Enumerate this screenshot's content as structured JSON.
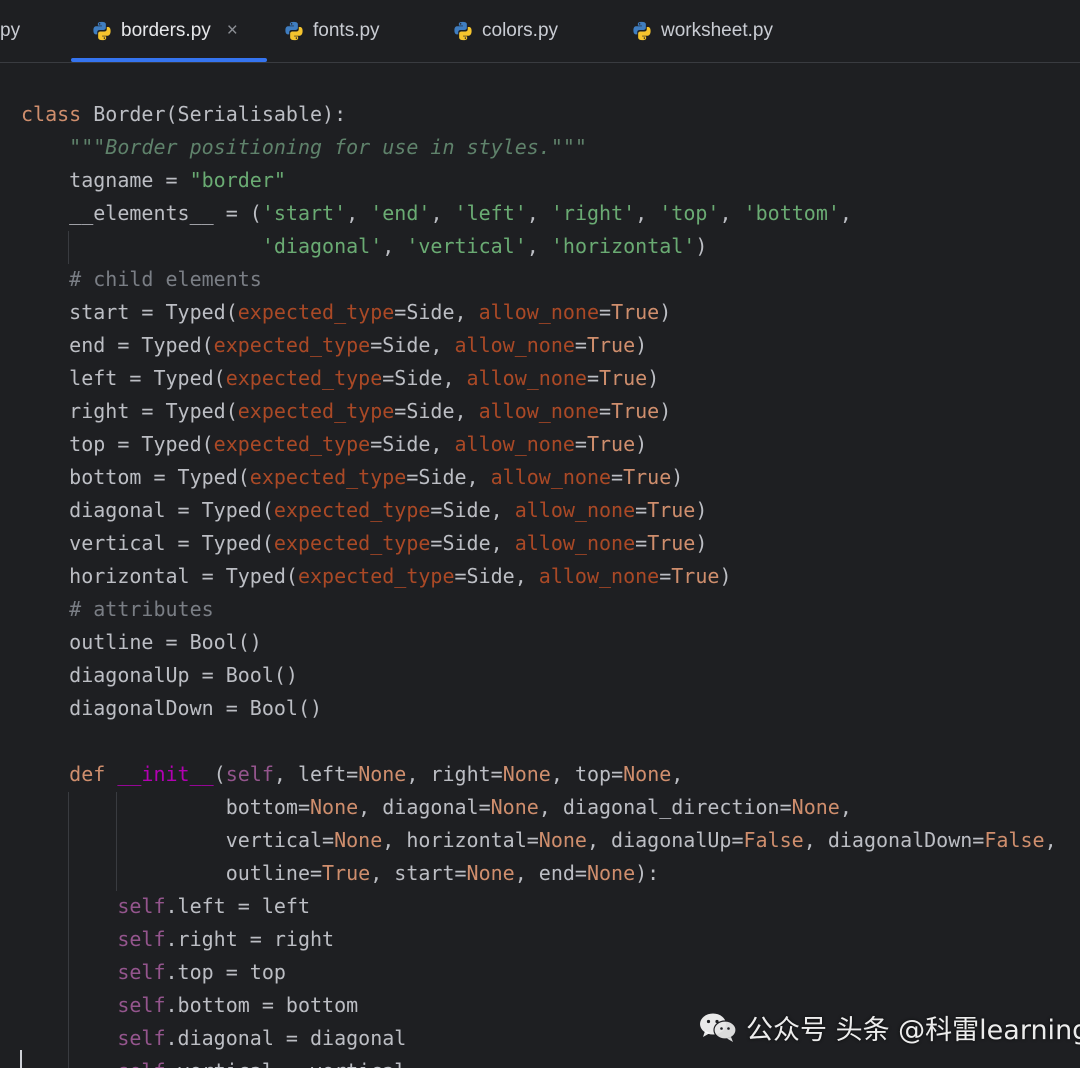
{
  "tabs": [
    {
      "label": "py",
      "active": false,
      "icon": "python-icon"
    },
    {
      "label": "borders.py",
      "active": true,
      "icon": "python-icon",
      "close": "×"
    },
    {
      "label": "fonts.py",
      "active": false,
      "icon": "python-icon"
    },
    {
      "label": "colors.py",
      "active": false,
      "icon": "python-icon"
    },
    {
      "label": "worksheet.py",
      "active": false,
      "icon": "python-icon"
    }
  ],
  "colors": {
    "background": "#1e1f22",
    "keyword": "#cf8e6d",
    "string": "#6aab73",
    "docstring": "#5f826b",
    "comment": "#7a7e85",
    "parameter": "#aa4926",
    "self": "#94558d",
    "default": "#bcbec4",
    "tab_underline": "#3574f0"
  },
  "code": [
    [
      [
        "",
        "class "
      ],
      [
        "df",
        "Border(Serialisable):"
      ]
    ],
    [
      [
        "df",
        "    "
      ],
      [
        "doc",
        "\"\"\"Border positioning for use in styles.\"\"\""
      ]
    ],
    [
      [
        "df",
        "    tagname = "
      ],
      [
        "str",
        "\"border\""
      ]
    ],
    [
      [
        "df",
        "    __elements__ = ("
      ],
      [
        "str",
        "'start'"
      ],
      [
        "df",
        ", "
      ],
      [
        "str",
        "'end'"
      ],
      [
        "df",
        ", "
      ],
      [
        "str",
        "'left'"
      ],
      [
        "df",
        ", "
      ],
      [
        "str",
        "'right'"
      ],
      [
        "df",
        ", "
      ],
      [
        "str",
        "'top'"
      ],
      [
        "df",
        ", "
      ],
      [
        "str",
        "'bottom'"
      ],
      [
        "df",
        ","
      ]
    ],
    [
      [
        "df",
        "                    "
      ],
      [
        "str",
        "'diagonal'"
      ],
      [
        "df",
        ", "
      ],
      [
        "str",
        "'vertical'"
      ],
      [
        "df",
        ", "
      ],
      [
        "str",
        "'horizontal'"
      ],
      [
        "df",
        ")"
      ]
    ],
    [
      [
        "df",
        "    "
      ],
      [
        "cmt",
        "# child elements"
      ]
    ],
    [
      [
        "df",
        "    start = Typed("
      ],
      [
        "prm",
        "expected_type"
      ],
      [
        "df",
        "=Side, "
      ],
      [
        "prm",
        "allow_none"
      ],
      [
        "df",
        "="
      ],
      [
        "kw",
        "True"
      ],
      [
        "df",
        ")"
      ]
    ],
    [
      [
        "df",
        "    end = Typed("
      ],
      [
        "prm",
        "expected_type"
      ],
      [
        "df",
        "=Side, "
      ],
      [
        "prm",
        "allow_none"
      ],
      [
        "df",
        "="
      ],
      [
        "kw",
        "True"
      ],
      [
        "df",
        ")"
      ]
    ],
    [
      [
        "df",
        "    left = Typed("
      ],
      [
        "prm",
        "expected_type"
      ],
      [
        "df",
        "=Side, "
      ],
      [
        "prm",
        "allow_none"
      ],
      [
        "df",
        "="
      ],
      [
        "kw",
        "True"
      ],
      [
        "df",
        ")"
      ]
    ],
    [
      [
        "df",
        "    right = Typed("
      ],
      [
        "prm",
        "expected_type"
      ],
      [
        "df",
        "=Side, "
      ],
      [
        "prm",
        "allow_none"
      ],
      [
        "df",
        "="
      ],
      [
        "kw",
        "True"
      ],
      [
        "df",
        ")"
      ]
    ],
    [
      [
        "df",
        "    top = Typed("
      ],
      [
        "prm",
        "expected_type"
      ],
      [
        "df",
        "=Side, "
      ],
      [
        "prm",
        "allow_none"
      ],
      [
        "df",
        "="
      ],
      [
        "kw",
        "True"
      ],
      [
        "df",
        ")"
      ]
    ],
    [
      [
        "df",
        "    bottom = Typed("
      ],
      [
        "prm",
        "expected_type"
      ],
      [
        "df",
        "=Side, "
      ],
      [
        "prm",
        "allow_none"
      ],
      [
        "df",
        "="
      ],
      [
        "kw",
        "True"
      ],
      [
        "df",
        ")"
      ]
    ],
    [
      [
        "df",
        "    diagonal = Typed("
      ],
      [
        "prm",
        "expected_type"
      ],
      [
        "df",
        "=Side, "
      ],
      [
        "prm",
        "allow_none"
      ],
      [
        "df",
        "="
      ],
      [
        "kw",
        "True"
      ],
      [
        "df",
        ")"
      ]
    ],
    [
      [
        "df",
        "    vertical = Typed("
      ],
      [
        "prm",
        "expected_type"
      ],
      [
        "df",
        "=Side, "
      ],
      [
        "prm",
        "allow_none"
      ],
      [
        "df",
        "="
      ],
      [
        "kw",
        "True"
      ],
      [
        "df",
        ")"
      ]
    ],
    [
      [
        "df",
        "    horizontal = Typed("
      ],
      [
        "prm",
        "expected_type"
      ],
      [
        "df",
        "=Side, "
      ],
      [
        "prm",
        "allow_none"
      ],
      [
        "df",
        "="
      ],
      [
        "kw",
        "True"
      ],
      [
        "df",
        ")"
      ]
    ],
    [
      [
        "df",
        "    "
      ],
      [
        "cmt",
        "# attributes"
      ]
    ],
    [
      [
        "df",
        "    outline = Bool()"
      ]
    ],
    [
      [
        "df",
        "    diagonalUp = Bool()"
      ]
    ],
    [
      [
        "df",
        "    diagonalDown = Bool()"
      ]
    ],
    [
      [
        "df",
        ""
      ]
    ],
    [
      [
        "df",
        "    "
      ],
      [
        "kw",
        "def "
      ],
      [
        "mg",
        "__init__"
      ],
      [
        "df",
        "("
      ],
      [
        "slf",
        "self"
      ],
      [
        "df",
        ", left="
      ],
      [
        "kw",
        "None"
      ],
      [
        "df",
        ", right="
      ],
      [
        "kw",
        "None"
      ],
      [
        "df",
        ", top="
      ],
      [
        "kw",
        "None"
      ],
      [
        "df",
        ","
      ]
    ],
    [
      [
        "df",
        "                 bottom="
      ],
      [
        "kw",
        "None"
      ],
      [
        "df",
        ", diagonal="
      ],
      [
        "kw",
        "None"
      ],
      [
        "df",
        ", diagonal_direction="
      ],
      [
        "kw",
        "None"
      ],
      [
        "df",
        ","
      ]
    ],
    [
      [
        "df",
        "                 vertical="
      ],
      [
        "kw",
        "None"
      ],
      [
        "df",
        ", horizontal="
      ],
      [
        "kw",
        "None"
      ],
      [
        "df",
        ", diagonalUp="
      ],
      [
        "kw",
        "False"
      ],
      [
        "df",
        ", diagonalDown="
      ],
      [
        "kw",
        "False"
      ],
      [
        "df",
        ","
      ]
    ],
    [
      [
        "df",
        "                 outline="
      ],
      [
        "kw",
        "True"
      ],
      [
        "df",
        ", start="
      ],
      [
        "kw",
        "None"
      ],
      [
        "df",
        ", end="
      ],
      [
        "kw",
        "None"
      ],
      [
        "df",
        "):"
      ]
    ],
    [
      [
        "df",
        "        "
      ],
      [
        "slf",
        "self"
      ],
      [
        "df",
        ".left = left"
      ]
    ],
    [
      [
        "df",
        "        "
      ],
      [
        "slf",
        "self"
      ],
      [
        "df",
        ".right = right"
      ]
    ],
    [
      [
        "df",
        "        "
      ],
      [
        "slf",
        "self"
      ],
      [
        "df",
        ".top = top"
      ]
    ],
    [
      [
        "df",
        "        "
      ],
      [
        "slf",
        "self"
      ],
      [
        "df",
        ".bottom = bottom"
      ]
    ],
    [
      [
        "df",
        "        "
      ],
      [
        "slf",
        "self"
      ],
      [
        "df",
        ".diagonal = diagonal"
      ]
    ],
    [
      [
        "df",
        "        "
      ],
      [
        "slf",
        "self"
      ],
      [
        "df",
        ".vertical = vertical"
      ]
    ]
  ],
  "watermark": {
    "icon": "wechat-icon",
    "text": "公众号 头条 @科雷learning"
  }
}
